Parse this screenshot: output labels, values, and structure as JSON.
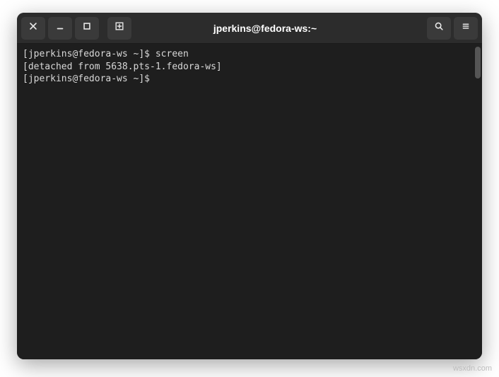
{
  "window": {
    "title": "jperkins@fedora-ws:~"
  },
  "terminal": {
    "lines": [
      "[jperkins@fedora-ws ~]$ screen",
      "[detached from 5638.pts-1.fedora-ws]",
      "[jperkins@fedora-ws ~]$ "
    ]
  },
  "watermark": "wsxdn.com"
}
